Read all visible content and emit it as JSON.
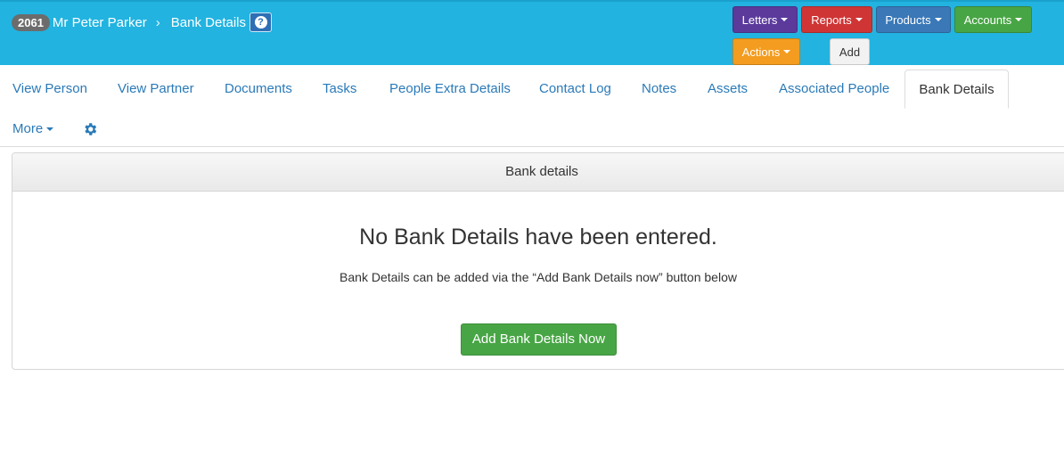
{
  "header": {
    "record_id": "2061",
    "person_name": "Mr Peter Parker",
    "separator": "›",
    "page_name": "Bank Details",
    "help_glyph": "?"
  },
  "toolbar": {
    "letters": "Letters",
    "reports": "Reports",
    "products": "Products",
    "accounts": "Accounts",
    "actions": "Actions",
    "add": "Add",
    "colors": {
      "bar": "#22b3e0",
      "letters": "#5b3a9c",
      "reports": "#cf3535",
      "products": "#3a78b8",
      "accounts": "#48a545",
      "actions": "#f39c1f"
    }
  },
  "tabs": [
    {
      "label": "View Person"
    },
    {
      "label": "View Partner"
    },
    {
      "label": "Documents"
    },
    {
      "label": "Tasks"
    },
    {
      "label": "People Extra Details"
    },
    {
      "label": "Contact Log"
    },
    {
      "label": "Notes"
    },
    {
      "label": "Assets"
    },
    {
      "label": "Associated People"
    },
    {
      "label": "Bank Details",
      "active": true
    }
  ],
  "more_tab": "More",
  "settings_icon": "gear-icon",
  "panel": {
    "heading": "Bank details",
    "empty_title": "No Bank Details have been entered.",
    "empty_text": "Bank Details can be added via the “Add Bank Details now” button below",
    "add_button": "Add Bank Details Now"
  }
}
